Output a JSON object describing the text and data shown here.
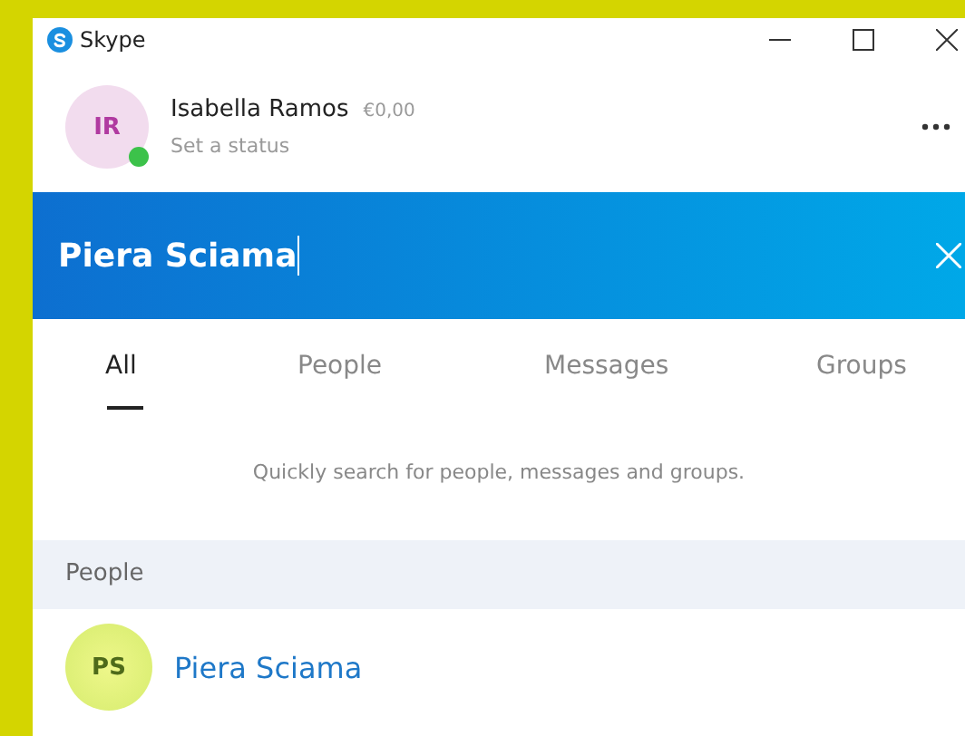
{
  "window": {
    "title": "Skype"
  },
  "profile": {
    "initials": "IR",
    "name": "Isabella Ramos",
    "credit": "€0,00",
    "status_text": "Set a status",
    "online": true
  },
  "search": {
    "value": "Piera Sciama"
  },
  "tabs": [
    {
      "label": "All",
      "selected": true
    },
    {
      "label": "People",
      "selected": false
    },
    {
      "label": "Messages",
      "selected": false
    },
    {
      "label": "Groups",
      "selected": false
    }
  ],
  "hint": "Quickly search for people, messages and groups.",
  "sections": [
    {
      "title": "People",
      "results": [
        {
          "initials": "PS",
          "name": "Piera Sciama"
        }
      ]
    }
  ]
}
